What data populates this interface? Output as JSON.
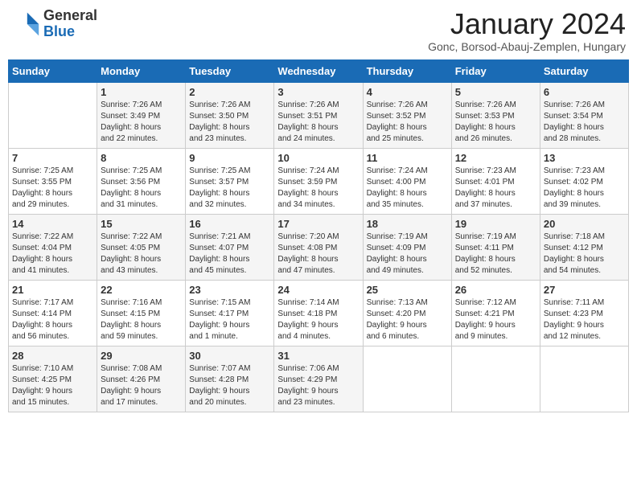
{
  "logo": {
    "general": "General",
    "blue": "Blue"
  },
  "title": "January 2024",
  "location": "Gonc, Borsod-Abauj-Zemplen, Hungary",
  "days_header": [
    "Sunday",
    "Monday",
    "Tuesday",
    "Wednesday",
    "Thursday",
    "Friday",
    "Saturday"
  ],
  "weeks": [
    [
      {
        "num": "",
        "info": ""
      },
      {
        "num": "1",
        "info": "Sunrise: 7:26 AM\nSunset: 3:49 PM\nDaylight: 8 hours\nand 22 minutes."
      },
      {
        "num": "2",
        "info": "Sunrise: 7:26 AM\nSunset: 3:50 PM\nDaylight: 8 hours\nand 23 minutes."
      },
      {
        "num": "3",
        "info": "Sunrise: 7:26 AM\nSunset: 3:51 PM\nDaylight: 8 hours\nand 24 minutes."
      },
      {
        "num": "4",
        "info": "Sunrise: 7:26 AM\nSunset: 3:52 PM\nDaylight: 8 hours\nand 25 minutes."
      },
      {
        "num": "5",
        "info": "Sunrise: 7:26 AM\nSunset: 3:53 PM\nDaylight: 8 hours\nand 26 minutes."
      },
      {
        "num": "6",
        "info": "Sunrise: 7:26 AM\nSunset: 3:54 PM\nDaylight: 8 hours\nand 28 minutes."
      }
    ],
    [
      {
        "num": "7",
        "info": "Sunrise: 7:25 AM\nSunset: 3:55 PM\nDaylight: 8 hours\nand 29 minutes."
      },
      {
        "num": "8",
        "info": "Sunrise: 7:25 AM\nSunset: 3:56 PM\nDaylight: 8 hours\nand 31 minutes."
      },
      {
        "num": "9",
        "info": "Sunrise: 7:25 AM\nSunset: 3:57 PM\nDaylight: 8 hours\nand 32 minutes."
      },
      {
        "num": "10",
        "info": "Sunrise: 7:24 AM\nSunset: 3:59 PM\nDaylight: 8 hours\nand 34 minutes."
      },
      {
        "num": "11",
        "info": "Sunrise: 7:24 AM\nSunset: 4:00 PM\nDaylight: 8 hours\nand 35 minutes."
      },
      {
        "num": "12",
        "info": "Sunrise: 7:23 AM\nSunset: 4:01 PM\nDaylight: 8 hours\nand 37 minutes."
      },
      {
        "num": "13",
        "info": "Sunrise: 7:23 AM\nSunset: 4:02 PM\nDaylight: 8 hours\nand 39 minutes."
      }
    ],
    [
      {
        "num": "14",
        "info": "Sunrise: 7:22 AM\nSunset: 4:04 PM\nDaylight: 8 hours\nand 41 minutes."
      },
      {
        "num": "15",
        "info": "Sunrise: 7:22 AM\nSunset: 4:05 PM\nDaylight: 8 hours\nand 43 minutes."
      },
      {
        "num": "16",
        "info": "Sunrise: 7:21 AM\nSunset: 4:07 PM\nDaylight: 8 hours\nand 45 minutes."
      },
      {
        "num": "17",
        "info": "Sunrise: 7:20 AM\nSunset: 4:08 PM\nDaylight: 8 hours\nand 47 minutes."
      },
      {
        "num": "18",
        "info": "Sunrise: 7:19 AM\nSunset: 4:09 PM\nDaylight: 8 hours\nand 49 minutes."
      },
      {
        "num": "19",
        "info": "Sunrise: 7:19 AM\nSunset: 4:11 PM\nDaylight: 8 hours\nand 52 minutes."
      },
      {
        "num": "20",
        "info": "Sunrise: 7:18 AM\nSunset: 4:12 PM\nDaylight: 8 hours\nand 54 minutes."
      }
    ],
    [
      {
        "num": "21",
        "info": "Sunrise: 7:17 AM\nSunset: 4:14 PM\nDaylight: 8 hours\nand 56 minutes."
      },
      {
        "num": "22",
        "info": "Sunrise: 7:16 AM\nSunset: 4:15 PM\nDaylight: 8 hours\nand 59 minutes."
      },
      {
        "num": "23",
        "info": "Sunrise: 7:15 AM\nSunset: 4:17 PM\nDaylight: 9 hours\nand 1 minute."
      },
      {
        "num": "24",
        "info": "Sunrise: 7:14 AM\nSunset: 4:18 PM\nDaylight: 9 hours\nand 4 minutes."
      },
      {
        "num": "25",
        "info": "Sunrise: 7:13 AM\nSunset: 4:20 PM\nDaylight: 9 hours\nand 6 minutes."
      },
      {
        "num": "26",
        "info": "Sunrise: 7:12 AM\nSunset: 4:21 PM\nDaylight: 9 hours\nand 9 minutes."
      },
      {
        "num": "27",
        "info": "Sunrise: 7:11 AM\nSunset: 4:23 PM\nDaylight: 9 hours\nand 12 minutes."
      }
    ],
    [
      {
        "num": "28",
        "info": "Sunrise: 7:10 AM\nSunset: 4:25 PM\nDaylight: 9 hours\nand 15 minutes."
      },
      {
        "num": "29",
        "info": "Sunrise: 7:08 AM\nSunset: 4:26 PM\nDaylight: 9 hours\nand 17 minutes."
      },
      {
        "num": "30",
        "info": "Sunrise: 7:07 AM\nSunset: 4:28 PM\nDaylight: 9 hours\nand 20 minutes."
      },
      {
        "num": "31",
        "info": "Sunrise: 7:06 AM\nSunset: 4:29 PM\nDaylight: 9 hours\nand 23 minutes."
      },
      {
        "num": "",
        "info": ""
      },
      {
        "num": "",
        "info": ""
      },
      {
        "num": "",
        "info": ""
      }
    ]
  ]
}
